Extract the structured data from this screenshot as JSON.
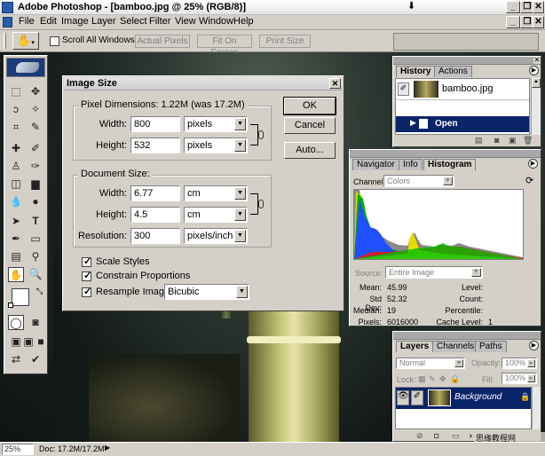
{
  "app": {
    "title": "Adobe Photoshop - [bamboo.jpg @ 25% (RGB/8)]",
    "window_buttons": [
      "_",
      "❐",
      "✕"
    ]
  },
  "menu": [
    "File",
    "Edit",
    "Image",
    "Layer",
    "Select",
    "Filter",
    "View",
    "Window",
    "Help"
  ],
  "options": {
    "scroll_all_label": "Scroll All Windows",
    "scroll_all_checked": false,
    "actual_pixels": "Actual Pixels",
    "fit_on_screen": "Fit On Screen",
    "print_size": "Print Size"
  },
  "dialog": {
    "title": "Image Size",
    "pixel_dimensions": "Pixel Dimensions:  1.22M (was 17.2M)",
    "width_label": "Width:",
    "width_value": "800",
    "width_unit": "pixels",
    "height_label": "Height:",
    "height_value": "532",
    "height_unit": "pixels",
    "document_size": "Document Size:",
    "doc_width_label": "Width:",
    "doc_width_value": "6.77",
    "doc_width_unit": "cm",
    "doc_height_label": "Height:",
    "doc_height_value": "4.5",
    "doc_height_unit": "cm",
    "resolution_label": "Resolution:",
    "resolution_value": "300",
    "resolution_unit": "pixels/inch",
    "scale_styles": "Scale Styles",
    "constrain": "Constrain Proportions",
    "resample": "Resample Image:",
    "resample_method": "Bicubic",
    "ok": "OK",
    "cancel": "Cancel",
    "auto": "Auto..."
  },
  "history_panel": {
    "tabs": [
      "History",
      "Actions"
    ],
    "snapshot": "bamboo.jpg",
    "step": "Open"
  },
  "histogram_panel": {
    "tabs": [
      "Navigator",
      "Info",
      "Histogram"
    ],
    "channel_label": "Channel:",
    "channel_value": "Colors",
    "source_label": "Source:",
    "source_value": "Entire Image",
    "stats": {
      "mean_label": "Mean:",
      "mean": "45.99",
      "stddev_label": "Std Dev:",
      "stddev": "52.32",
      "median_label": "Median:",
      "median": "19",
      "pixels_label": "Pixels:",
      "pixels": "6016000",
      "level_label": "Level:",
      "count_label": "Count:",
      "percentile_label": "Percentile:",
      "cache_label": "Cache Level:",
      "cache": "1"
    }
  },
  "layers_panel": {
    "tabs": [
      "Layers",
      "Channels",
      "Paths"
    ],
    "blend_mode": "Normal",
    "opacity_label": "Opacity:",
    "opacity": "100%",
    "lock_label": "Lock:",
    "fill_label": "Fill:",
    "fill": "100%",
    "layer_name": "Background"
  },
  "status": {
    "zoom": "25%",
    "doc": "Doc: 17.2M/17.2M"
  },
  "watermark": "思缘教程网 www.missyuan.net"
}
